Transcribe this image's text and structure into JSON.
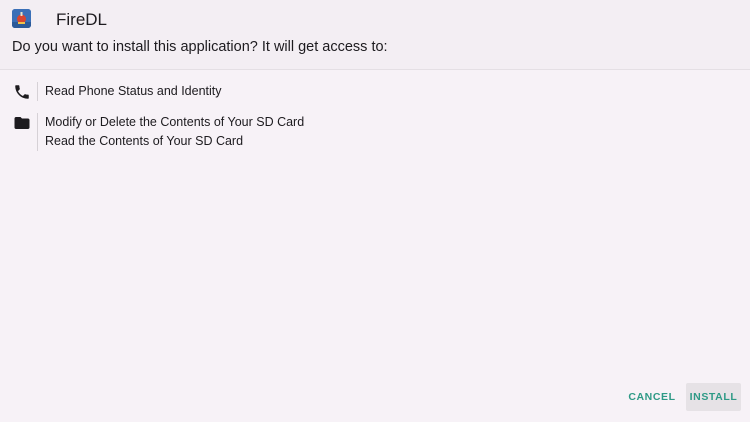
{
  "dialog": {
    "app_name": "FireDL",
    "app_icon": "firedl-app-icon",
    "prompt": "Do you want to install this application? It will get access to:"
  },
  "permissions": [
    {
      "icon": "phone-icon",
      "items": [
        "Read Phone Status and Identity"
      ]
    },
    {
      "icon": "folder-icon",
      "items": [
        "Modify or Delete the Contents of Your SD Card",
        "Read the Contents of Your SD Card"
      ]
    }
  ],
  "actions": {
    "cancel_label": "CANCEL",
    "install_label": "INSTALL"
  },
  "colors": {
    "background": "#f7f2f7",
    "accent": "#2e9a86",
    "install_button_bg": "#e6e2e6"
  }
}
